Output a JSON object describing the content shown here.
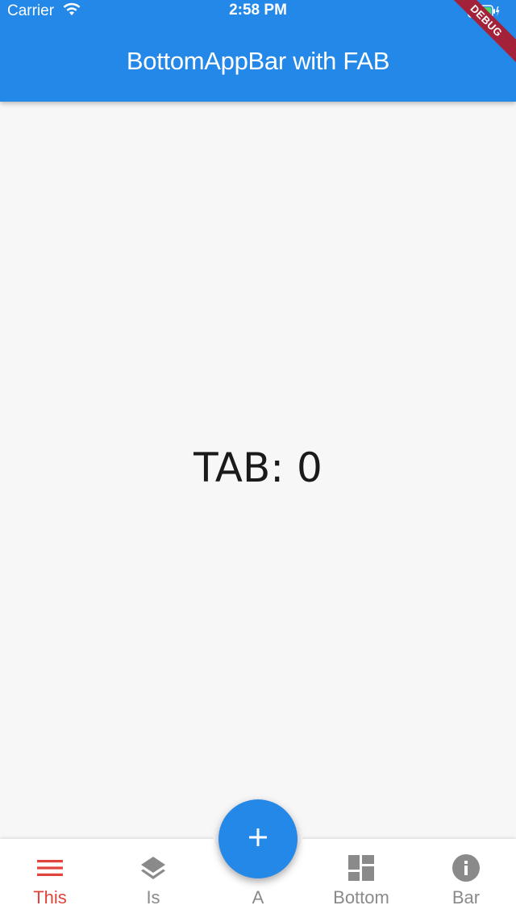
{
  "status_bar": {
    "carrier": "Carrier",
    "time": "2:58 PM"
  },
  "app_bar": {
    "title": "BottomAppBar with FAB",
    "debug_banner": "DEBUG",
    "color": "#2388e8"
  },
  "content": {
    "tab_text": "TAB: 0"
  },
  "fab": {
    "icon": "plus-icon",
    "color": "#2388e8"
  },
  "bottom_nav": {
    "active_color": "#e0443a",
    "inactive_color": "#8a8a8a",
    "items": [
      {
        "label": "This",
        "icon": "menu-icon",
        "active": true
      },
      {
        "label": "Is",
        "icon": "layers-icon",
        "active": false
      },
      {
        "label": "A",
        "icon": "",
        "active": false
      },
      {
        "label": "Bottom",
        "icon": "dashboard-icon",
        "active": false
      },
      {
        "label": "Bar",
        "icon": "info-icon",
        "active": false
      }
    ]
  }
}
